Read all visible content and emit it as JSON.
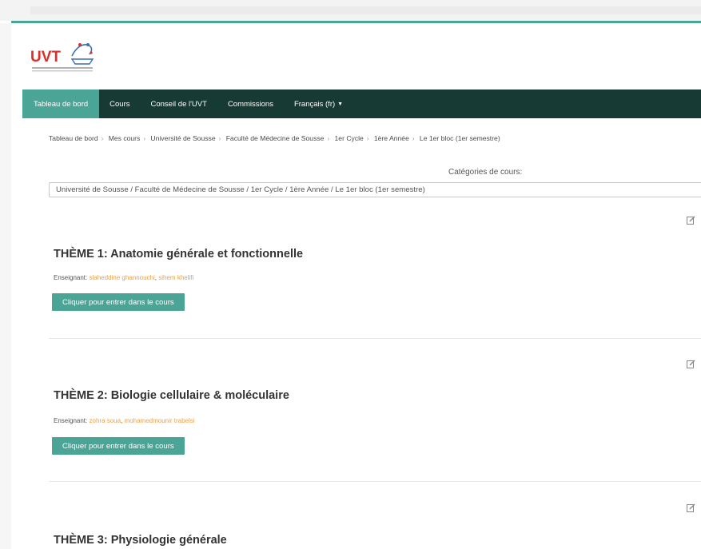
{
  "brand": {
    "logo_text": "UVT",
    "logo_color": "#d9302a",
    "accent": "#4aa596",
    "nav_bg": "#173a34"
  },
  "nav": {
    "items": [
      {
        "label": "Tableau de bord",
        "active": true
      },
      {
        "label": "Cours",
        "active": false
      },
      {
        "label": "Conseil de l'UVT",
        "active": false
      },
      {
        "label": "Commissions",
        "active": false
      },
      {
        "label": "Français (fr)",
        "active": false
      }
    ]
  },
  "breadcrumb": [
    "Tableau de bord",
    "Mes cours",
    "Université de Sousse",
    "Faculté de Médecine de Sousse",
    "1er Cycle",
    "1ère Année",
    "Le 1er bloc (1er semestre)"
  ],
  "categories": {
    "label": "Catégories de cours:",
    "selected": "Université de Sousse / Faculté de Médecine de Sousse / 1er Cycle / 1ère Année / Le 1er bloc (1er semestre)"
  },
  "courses": [
    {
      "title": "THÈME 1: Anatomie générale et fonctionnelle",
      "teacher_label": "Enseignant:",
      "teachers": [
        "slaheddine ghannouchi",
        "sihem khelifi"
      ],
      "button": "Cliquer pour entrer dans le cours"
    },
    {
      "title": "THÈME 2: Biologie cellulaire & moléculaire",
      "teacher_label": "Enseignant:",
      "teachers": [
        "zohra soua",
        "mohamedmounir trabelsi"
      ],
      "button": "Cliquer pour entrer dans le cours"
    },
    {
      "title": "THÈME 3: Physiologie générale"
    }
  ]
}
